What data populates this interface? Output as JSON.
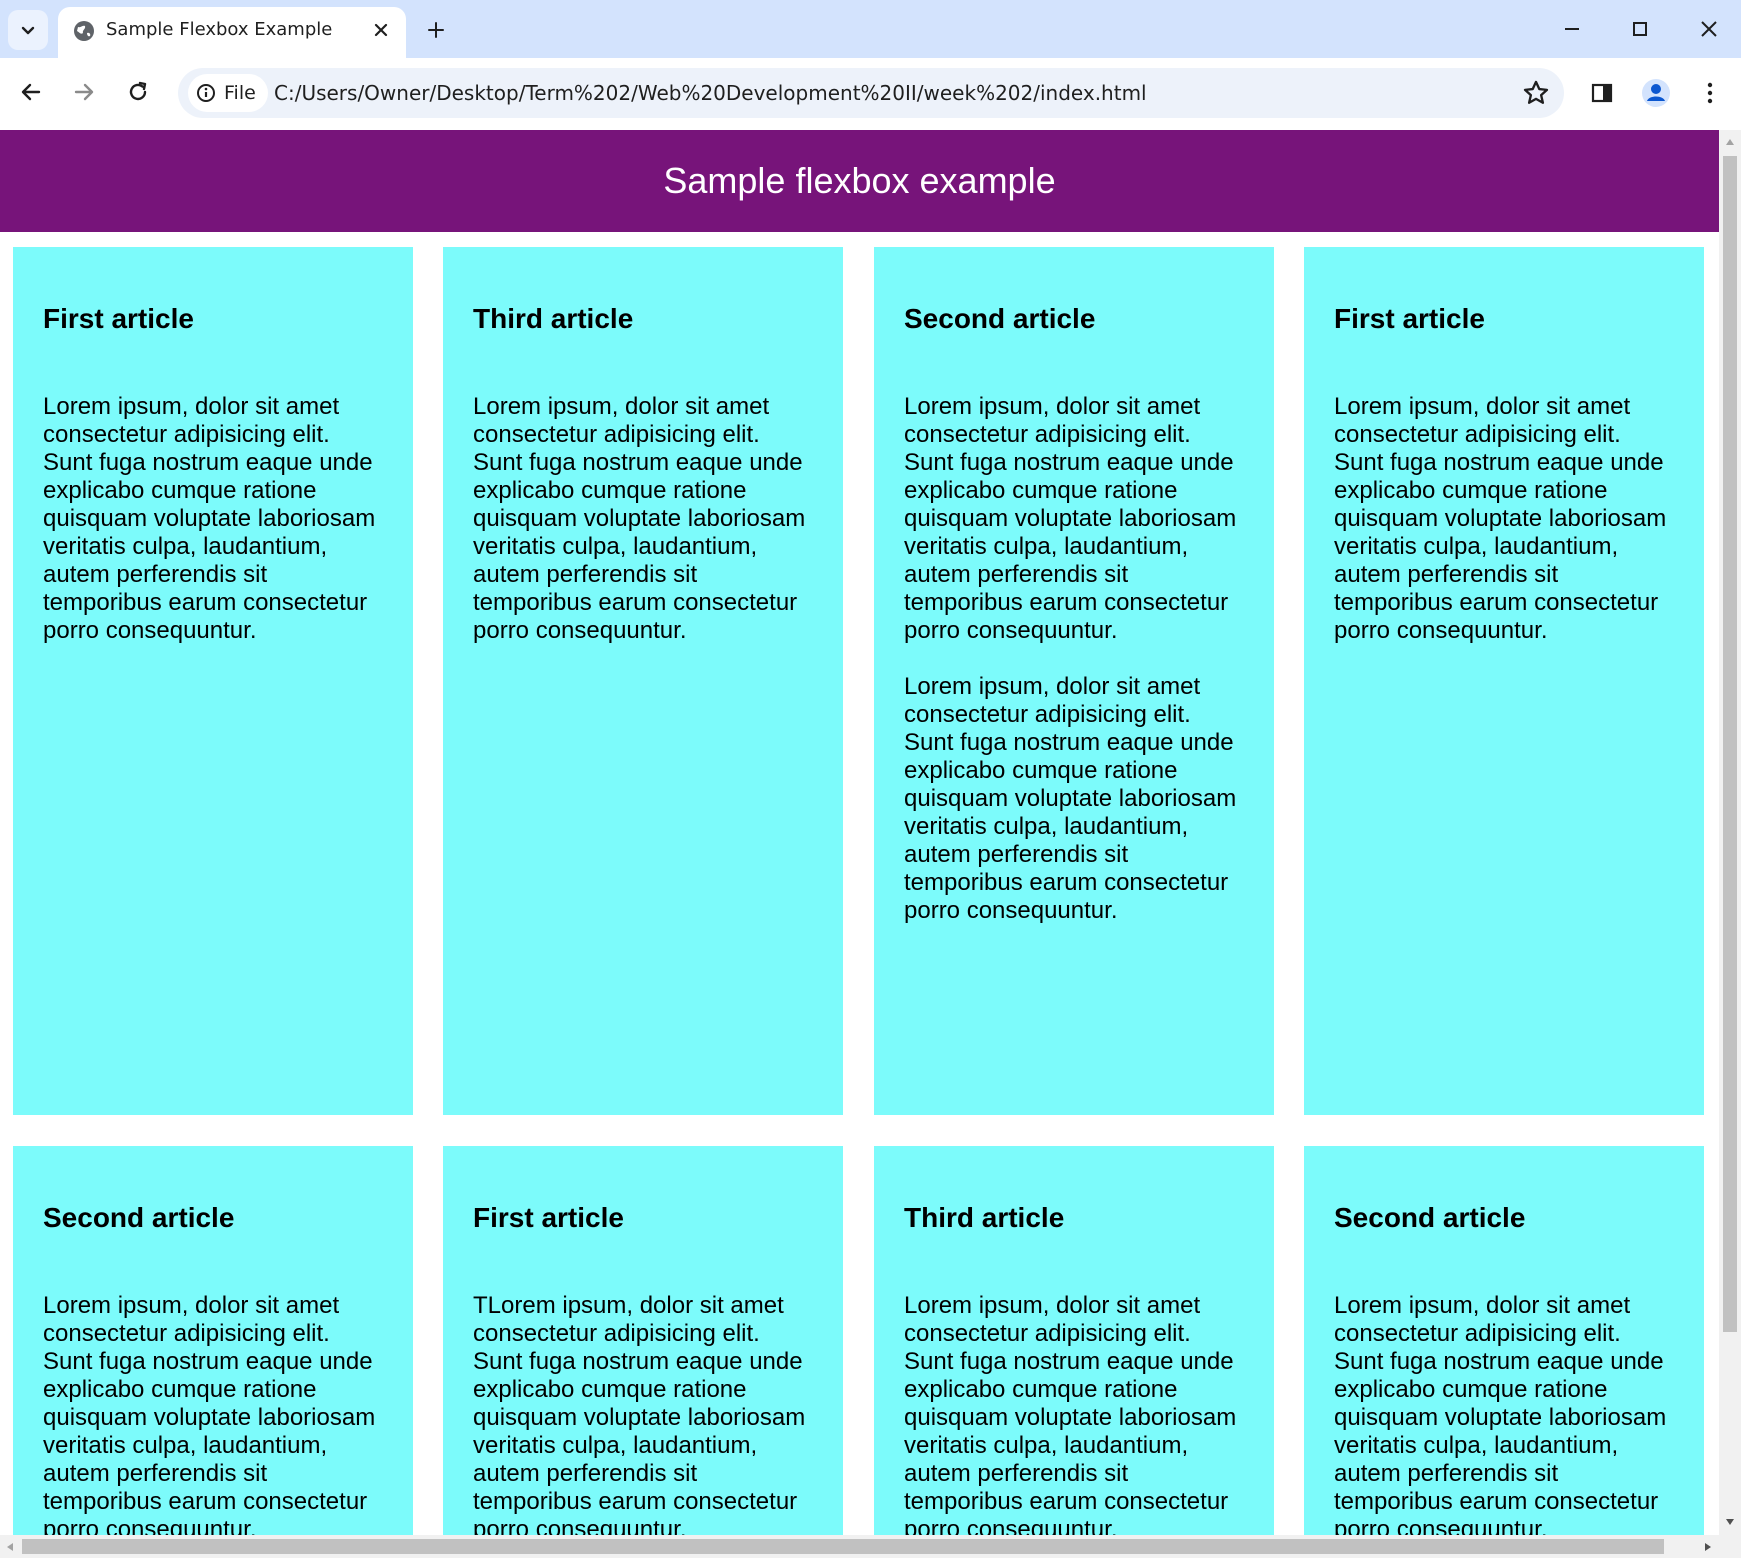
{
  "browser": {
    "tab_title": "Sample Flexbox Example",
    "chip_label": "File",
    "url": "C:/Users/Owner/Desktop/Term%202/Web%20Development%20II/week%202/index.html"
  },
  "page": {
    "heading": "Sample flexbox example",
    "cards": [
      {
        "title": "First article",
        "paragraphs": [
          "Lorem ipsum, dolor sit amet consectetur adipisicing elit. Sunt fuga nostrum eaque unde explicabo cumque ratione quisquam voluptate laboriosam veritatis culpa, laudantium, autem perferendis sit temporibus earum consectetur porro consequuntur."
        ]
      },
      {
        "title": "Third article",
        "paragraphs": [
          "Lorem ipsum, dolor sit amet consectetur adipisicing elit. Sunt fuga nostrum eaque unde explicabo cumque ratione quisquam voluptate laboriosam veritatis culpa, laudantium, autem perferendis sit temporibus earum consectetur porro consequuntur."
        ]
      },
      {
        "title": "Second article",
        "paragraphs": [
          "Lorem ipsum, dolor sit amet consectetur adipisicing elit. Sunt fuga nostrum eaque unde explicabo cumque ratione quisquam voluptate laboriosam veritatis culpa, laudantium, autem perferendis sit temporibus earum consectetur porro consequuntur.",
          "Lorem ipsum, dolor sit amet consectetur adipisicing elit. Sunt fuga nostrum eaque unde explicabo cumque ratione quisquam voluptate laboriosam veritatis culpa, laudantium, autem perferendis sit temporibus earum consectetur porro consequuntur."
        ]
      },
      {
        "title": "First article",
        "paragraphs": [
          "Lorem ipsum, dolor sit amet consectetur adipisicing elit. Sunt fuga nostrum eaque unde explicabo cumque ratione quisquam voluptate laboriosam veritatis culpa, laudantium, autem perferendis sit temporibus earum consectetur porro consequuntur."
        ]
      },
      {
        "title": "Second article",
        "paragraphs": [
          "Lorem ipsum, dolor sit amet consectetur adipisicing elit. Sunt fuga nostrum eaque unde explicabo cumque ratione quisquam voluptate laboriosam veritatis culpa, laudantium, autem perferendis sit temporibus earum consectetur porro consequuntur."
        ]
      },
      {
        "title": "First article",
        "paragraphs": [
          "TLorem ipsum, dolor sit amet consectetur adipisicing elit. Sunt fuga nostrum eaque unde explicabo cumque ratione quisquam voluptate laboriosam veritatis culpa, laudantium, autem perferendis sit temporibus earum consectetur porro consequuntur."
        ]
      },
      {
        "title": "Third article",
        "paragraphs": [
          "Lorem ipsum, dolor sit amet consectetur adipisicing elit. Sunt fuga nostrum eaque unde explicabo cumque ratione quisquam voluptate laboriosam veritatis culpa, laudantium, autem perferendis sit temporibus earum consectetur porro consequuntur."
        ]
      },
      {
        "title": "Second article",
        "paragraphs": [
          "Lorem ipsum, dolor sit amet consectetur adipisicing elit. Sunt fuga nostrum eaque unde explicabo cumque ratione quisquam voluptate laboriosam veritatis culpa, laudantium, autem perferendis sit temporibus earum consectetur porro consequuntur."
        ]
      }
    ]
  },
  "colors": {
    "header_bg": "#77147a",
    "card_bg": "#7cfbfb",
    "tabbar_bg": "#d3e3fd"
  },
  "icons": [
    "tab-search-icon",
    "globe-icon",
    "close-icon",
    "plus-icon",
    "minimize-icon",
    "maximize-icon",
    "window-close-icon",
    "back-arrow-icon",
    "forward-arrow-icon",
    "reload-icon",
    "info-icon",
    "star-icon",
    "side-panel-icon",
    "profile-icon",
    "more-vert-icon"
  ]
}
